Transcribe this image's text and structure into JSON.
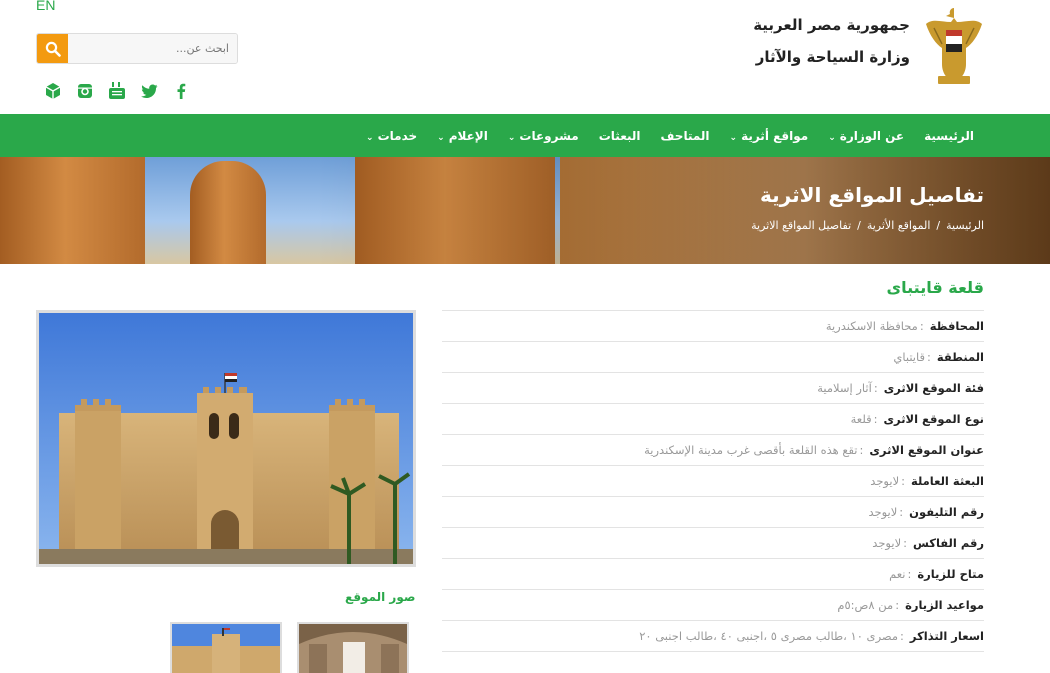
{
  "header": {
    "lang_link": "EN",
    "search_placeholder": "ابحث عن...",
    "brand_line1": "جمهورية مصر العربية",
    "brand_line2": "وزارة السياحة والآثار",
    "social_icons": [
      "cube-icon",
      "instagram-icon",
      "youtube-icon",
      "twitter-icon",
      "facebook-icon"
    ]
  },
  "nav": {
    "items": [
      {
        "label": "الرئيسية",
        "dropdown": false
      },
      {
        "label": "عن الوزارة",
        "dropdown": true
      },
      {
        "label": "مواقع أثرية",
        "dropdown": true
      },
      {
        "label": "المتاحف",
        "dropdown": false
      },
      {
        "label": "البعثات",
        "dropdown": false
      },
      {
        "label": "مشروعات",
        "dropdown": true
      },
      {
        "label": "الإعلام",
        "dropdown": true
      },
      {
        "label": "خدمات",
        "dropdown": true
      }
    ],
    "caret": "⌄"
  },
  "banner": {
    "title": "تفاصيل المواقع الاثرية",
    "breadcrumb": [
      "الرئيسية",
      "المواقع الأثرية",
      "تفاصيل المواقع الاثرية"
    ],
    "separator": "/"
  },
  "site": {
    "title": "قلعة قايتباى",
    "details": [
      {
        "label": "المحافظة",
        "value": "محافظة الاسكندرية"
      },
      {
        "label": "المنطقة",
        "value": "قايتباي"
      },
      {
        "label": "فئة الموقع الاثرى",
        "value": "آثار إسلامية"
      },
      {
        "label": "نوع الموقع الاثرى",
        "value": "قلعة"
      },
      {
        "label": "عنوان الموقع الاثرى",
        "value": "تقع هذه القلعة بأقصى غرب مدينة الإسكندرية"
      },
      {
        "label": "البعثة العاملة",
        "value": "لايوجد"
      },
      {
        "label": "رقم التليفون",
        "value": "لايوجد"
      },
      {
        "label": "رقم الفاكس",
        "value": "لايوجد"
      },
      {
        "label": "متاح للزيارة",
        "value": "نعم"
      },
      {
        "label": "مواعيد الزيارة",
        "value": "من ٨ص:٥م"
      },
      {
        "label": "اسعار التذاكر",
        "value": "مصرى ١٠ ،طالب مصرى ٥ ،اجنبى ٤٠ ،طالب اجنبى ٢٠"
      }
    ],
    "colon": ":",
    "gallery_title": "صور الموقع"
  },
  "colors": {
    "accent_green": "#2aa84a",
    "search_orange": "#f39a10"
  }
}
